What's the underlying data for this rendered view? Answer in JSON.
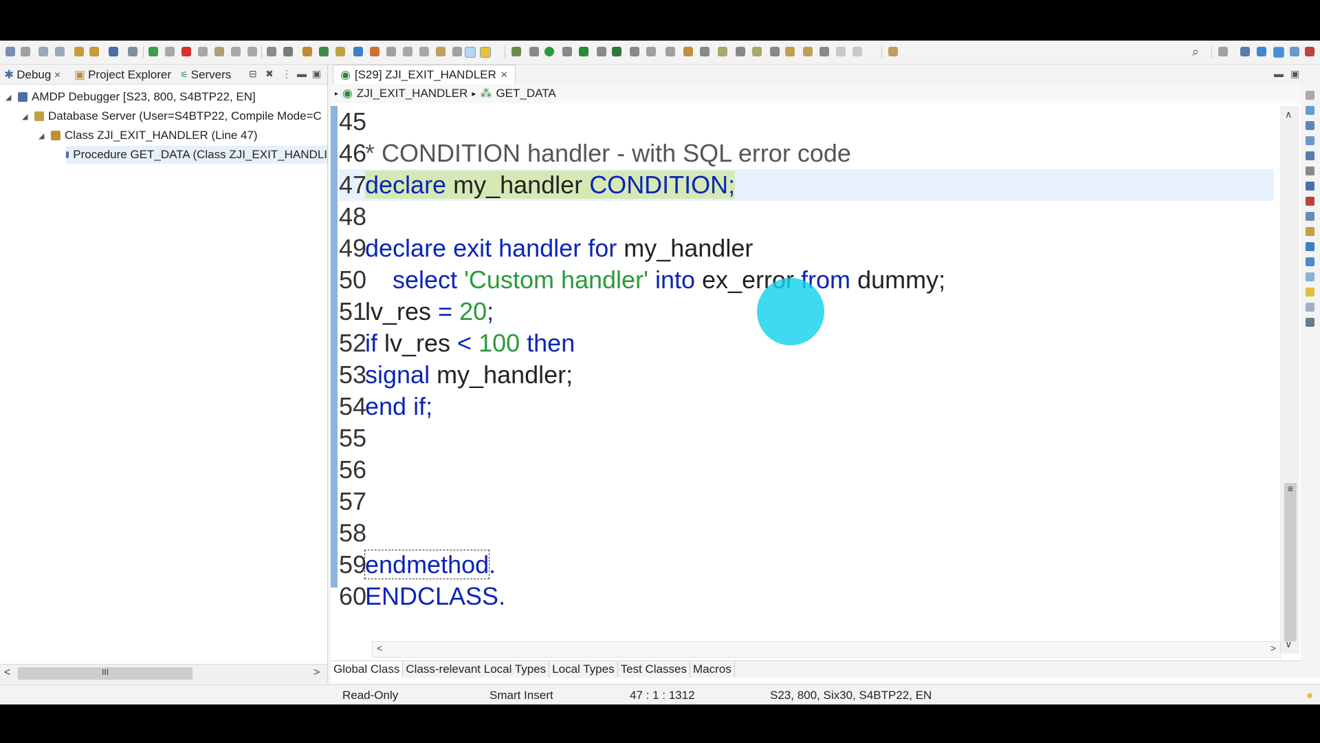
{
  "toolbar": {
    "icons": [
      "new-icon",
      "save-icon",
      "undo-icon",
      "redo-icon",
      "debug-icon",
      "run-icon",
      "stop-icon",
      "step-into-icon",
      "step-over-icon",
      "step-return-icon",
      "search-icon",
      "perspective-icon"
    ]
  },
  "left_panel": {
    "tabs": [
      {
        "label": "Debug",
        "close": "✕"
      },
      {
        "label": "Project Explorer"
      },
      {
        "label": "Servers"
      }
    ],
    "tree": [
      {
        "label": "AMDP Debugger [S23, 800, S4BTP22, EN]",
        "twisty": "◢"
      },
      {
        "label": "Database Server (User=S4BTP22, Compile Mode=C",
        "twisty": "◢"
      },
      {
        "label": "Class ZJI_EXIT_HANDLER (Line 47)",
        "twisty": "◢"
      },
      {
        "label": "Procedure GET_DATA (Class ZJI_EXIT_HANDLI",
        "twisty": ""
      }
    ],
    "scroll": {
      "left": "<",
      "right": ">",
      "thumb": "III"
    }
  },
  "editor": {
    "tab_label": "[S29] ZJI_EXIT_HANDLER",
    "tab_close": "✕",
    "breadcrumb": {
      "class": "ZJI_EXIT_HANDLER",
      "sep": "▸",
      "method": "GET_DATA"
    },
    "lines": {
      "l45": "45",
      "l46": "46",
      "l46_text": "* CONDITION handler - with SQL error code",
      "l47": "47",
      "l47_kw": "declare",
      "l47_id": " my_handler ",
      "l47_kw2": "CONDITION;",
      "l48": "48",
      "l49": "49",
      "l49_kw": "declare exit handler for",
      "l49_id": " my_handler",
      "l50": "50",
      "l50_kw": "    select ",
      "l50_str": "'Custom handler'",
      "l50_kw2": " into ",
      "l50_id": "ex_error",
      "l50_kw3": " from ",
      "l50_id2": "dummy;",
      "l51": "51",
      "l51_id": "lv_res ",
      "l51_op": "=",
      "l51_num": " 20",
      "l51_semi": ";",
      "l52": "52",
      "l52_kw": "if",
      "l52_id": " lv_res ",
      "l52_op": "<",
      "l52_num": " 100",
      "l52_kw2": " then",
      "l53": "53",
      "l53_kw": "signal",
      "l53_id": " my_handler;",
      "l54": "54",
      "l54_kw": "end if;",
      "l55": "55",
      "l56": "56",
      "l57": "57",
      "l58": "58",
      "l59": "59",
      "l59_kw": "endmethod",
      "l59_dot": ".",
      "l60": "60",
      "l60_kw": "ENDCLASS",
      "l60_dot": "."
    },
    "scroll": {
      "up": "∧",
      "down": "∨",
      "thumb": "≡",
      "left": "<",
      "right": ">"
    },
    "bottom_tabs": [
      "Global Class",
      "Class-relevant Local Types",
      "Local Types",
      "Test Classes",
      "Macros"
    ]
  },
  "status": {
    "mode": "Read-Only",
    "insert": "Smart Insert",
    "position": "47 : 1 : 1312",
    "system": "S23, 800, Six30, S4BTP22, EN"
  },
  "colors": {
    "keyword": "#0a24b8",
    "string": "#2a9a3a",
    "cursor_highlight": "#14d2eb",
    "current_line": "#e8f2fe"
  }
}
